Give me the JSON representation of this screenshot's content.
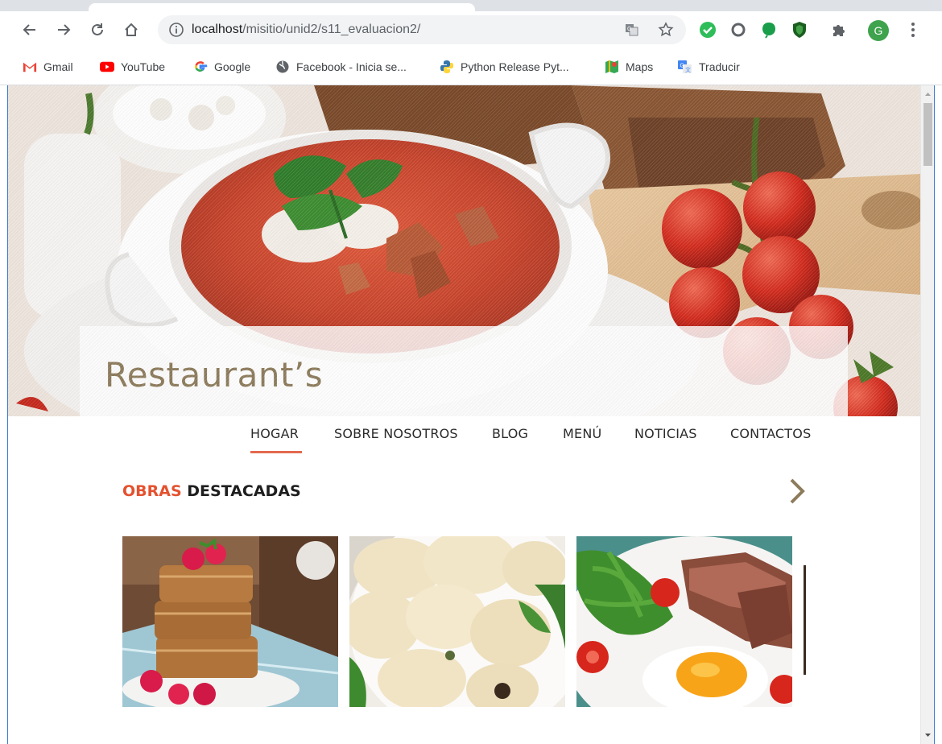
{
  "browser": {
    "url_host": "localhost",
    "url_path": "/misitio/unid2/s11_evaluacion2/",
    "profile_initial": "G",
    "bookmarks": [
      {
        "label": "Gmail",
        "icon": "gmail-icon"
      },
      {
        "label": "YouTube",
        "icon": "youtube-icon"
      },
      {
        "label": "Google",
        "icon": "google-icon"
      },
      {
        "label": "Facebook - Inicia se...",
        "icon": "globe-icon"
      },
      {
        "label": "Python Release Pyt...",
        "icon": "python-icon"
      },
      {
        "label": "Maps",
        "icon": "maps-icon"
      },
      {
        "label": "Traducir",
        "icon": "translate-icon"
      }
    ]
  },
  "site": {
    "brand": "Restaurant’s",
    "nav": [
      {
        "label": "HOGAR",
        "active": true
      },
      {
        "label": "SOBRE NOSOTROS",
        "active": false
      },
      {
        "label": "BLOG",
        "active": false
      },
      {
        "label": "MENÚ",
        "active": false
      },
      {
        "label": "NOTICIAS",
        "active": false
      },
      {
        "label": "CONTACTOS",
        "active": false
      }
    ],
    "featured": {
      "title_accent": "OBRAS",
      "title_rest": "DESTACADAS",
      "cards": [
        {
          "name": "raspberry-cake"
        },
        {
          "name": "dumplings"
        },
        {
          "name": "steak-egg-salad"
        }
      ]
    }
  },
  "colors": {
    "accent": "#e4512f",
    "brand": "#8d7c5c",
    "nav_underline": "#e36a4f"
  }
}
